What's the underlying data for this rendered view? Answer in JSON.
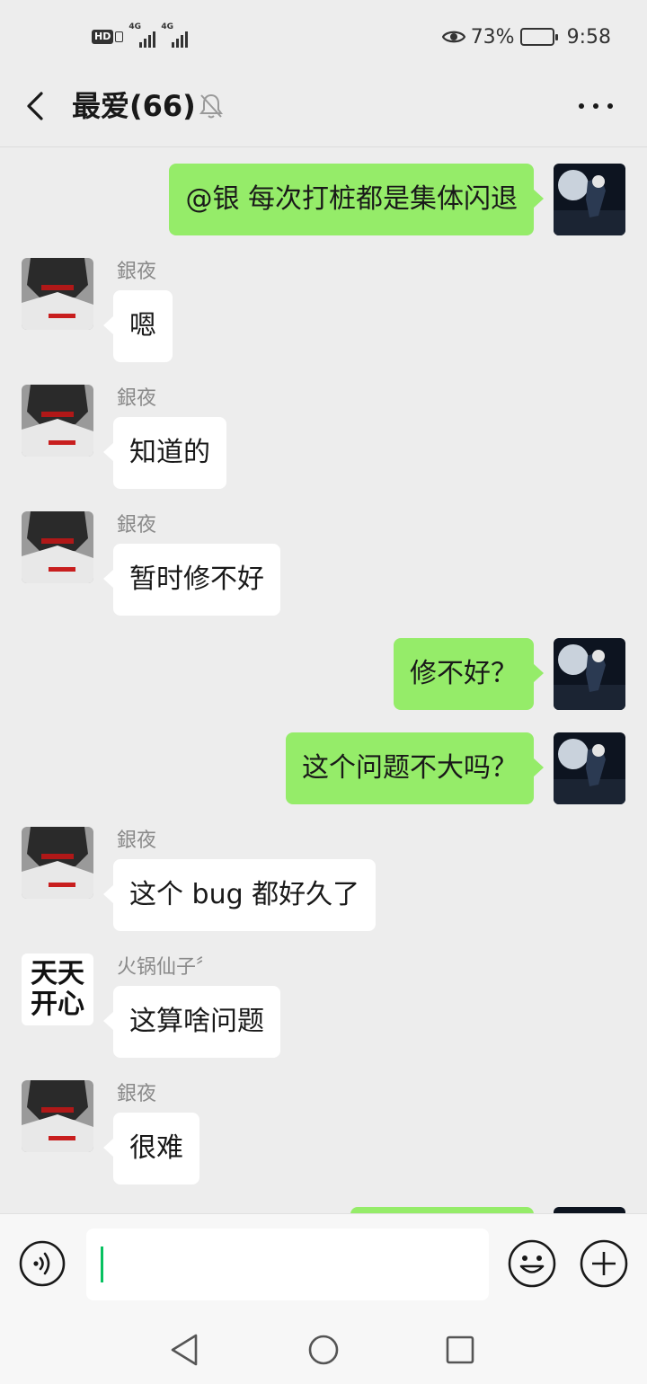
{
  "status_bar": {
    "signal_label_1": "4G",
    "signal_label_2": "4G",
    "battery_percent": "73%",
    "battery_level": 0.73,
    "time": "9:58"
  },
  "header": {
    "title": "最爱(66)",
    "muted": true
  },
  "messages": [
    {
      "side": "out",
      "sender": "",
      "text": "@银  每次打桩都是集体闪退",
      "avatar": "self"
    },
    {
      "side": "in",
      "sender": "銀夜",
      "text": "嗯",
      "avatar": "yinye"
    },
    {
      "side": "in",
      "sender": "銀夜",
      "text": "知道的",
      "avatar": "yinye"
    },
    {
      "side": "in",
      "sender": "銀夜",
      "text": "暂时修不好",
      "avatar": "yinye"
    },
    {
      "side": "out",
      "sender": "",
      "text": "修不好？",
      "avatar": "self"
    },
    {
      "side": "out",
      "sender": "",
      "text": "这个问题不大吗？",
      "avatar": "self"
    },
    {
      "side": "in",
      "sender": "銀夜",
      "text": "这个 bug 都好久了",
      "avatar": "yinye"
    },
    {
      "side": "in",
      "sender": "火锅仙子〞",
      "text": "这算啥问题",
      "avatar": "huoguo"
    },
    {
      "side": "in",
      "sender": "銀夜",
      "text": "很难",
      "avatar": "yinye"
    }
  ],
  "huoguo_avatar_text": {
    "line1": "天天",
    "line2": "开心"
  },
  "input": {
    "value": "",
    "placeholder": ""
  },
  "colors": {
    "outgoing_bubble": "#95ec69",
    "incoming_bubble": "#ffffff",
    "background": "#ededed",
    "caret": "#07c160"
  }
}
